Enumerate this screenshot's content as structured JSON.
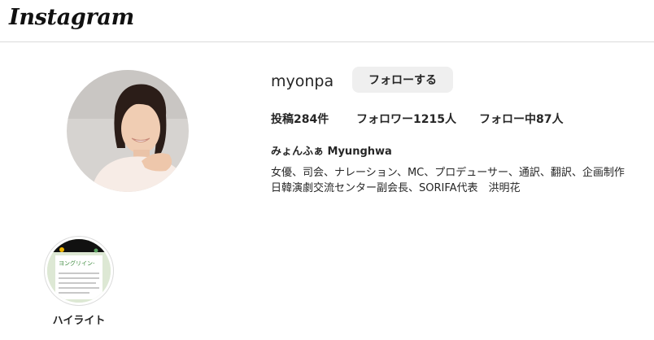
{
  "header": {
    "logo_text": "Instagram"
  },
  "profile": {
    "username": "myonpa",
    "follow_button_label": "フォローする",
    "stats": {
      "posts": "投稿284件",
      "followers": "フォロワー1215人",
      "following": "フォロー中87人"
    },
    "full_name": "みょんふぁ Myunghwa",
    "bio_lines": [
      "女優、司会、ナレーション、MC、プロデューサー、通訳、翻訳、企画制作",
      "日韓演劇交流センター副会長、SORIFA代表　洪明花"
    ]
  },
  "highlights": [
    {
      "label": "ハイライト",
      "cover_title": "ヨングリイン-"
    }
  ],
  "colors": {
    "border": "#dbdbdb",
    "button_bg": "#efefef",
    "text": "#262626"
  }
}
